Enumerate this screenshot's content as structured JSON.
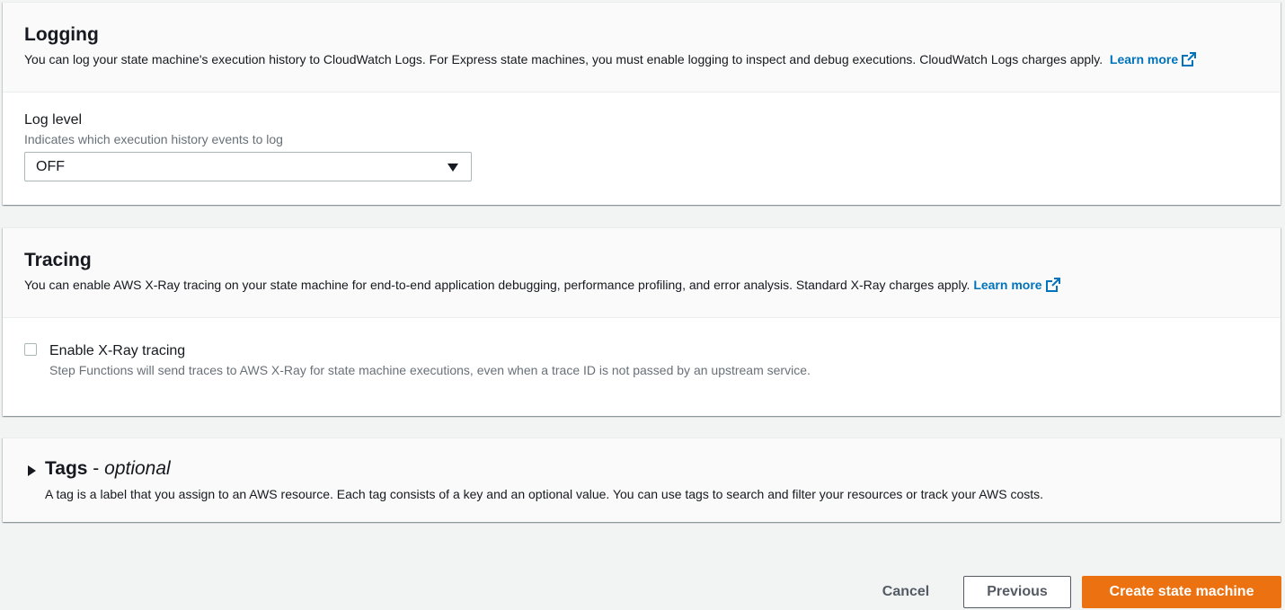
{
  "logging": {
    "title": "Logging",
    "description": "You can log your state machine's execution history to CloudWatch Logs. For Express state machines, you must enable logging to inspect and debug executions. CloudWatch Logs charges apply.",
    "learn_more": "Learn more",
    "log_level_label": "Log level",
    "log_level_hint": "Indicates which execution history events to log",
    "log_level_value": "OFF"
  },
  "tracing": {
    "title": "Tracing",
    "description": "You can enable AWS X-Ray tracing on your state machine for end-to-end application debugging, performance profiling, and error analysis. Standard X-Ray charges apply.",
    "learn_more": "Learn more",
    "checkbox_label": "Enable X-Ray tracing",
    "checkbox_hint": "Step Functions will send traces to AWS X-Ray for state machine executions, even when a trace ID is not passed by an upstream service.",
    "checkbox_checked": false
  },
  "tags": {
    "title": "Tags",
    "separator": " - ",
    "optional": "optional",
    "description": "A tag is a label that you assign to an AWS resource. Each tag consists of a key and an optional value. You can use tags to search and filter your resources or track your AWS costs."
  },
  "actions": {
    "cancel": "Cancel",
    "previous": "Previous",
    "create": "Create state machine"
  },
  "colors": {
    "accent": "#ec7211",
    "link": "#0073bb",
    "background": "#f2f3f3"
  },
  "icons": {
    "external_link": "external-link-icon",
    "dropdown": "caret-down-icon",
    "expand": "caret-right-icon"
  }
}
